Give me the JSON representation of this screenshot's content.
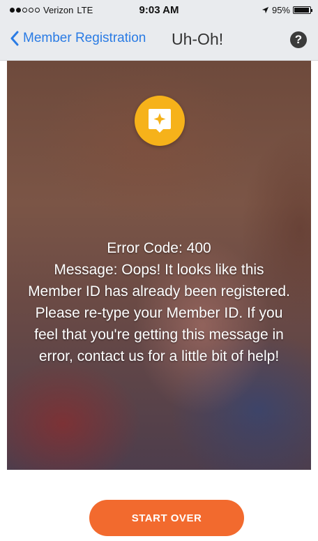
{
  "status_bar": {
    "carrier": "Verizon",
    "network": "LTE",
    "time": "9:03 AM",
    "battery": "95%",
    "battery_level": 0.95,
    "signal_dots_filled": 2,
    "signal_dots_total": 5
  },
  "nav": {
    "back_label": "Member Registration",
    "title": "Uh-Oh!",
    "help_label": "?",
    "accent_color": "#2a7be4"
  },
  "hero": {
    "icon": "star-chat-icon",
    "icon_color": "#f6b21a",
    "error_code": "Error Code: 400",
    "message": "Message: Oops! It looks like this Member ID has already been registered. Please re-type your Member ID. If you feel that you're getting this message in error, contact us for a little bit of help!"
  },
  "actions": {
    "start_over_label": "START OVER",
    "button_color": "#f26a2e"
  }
}
